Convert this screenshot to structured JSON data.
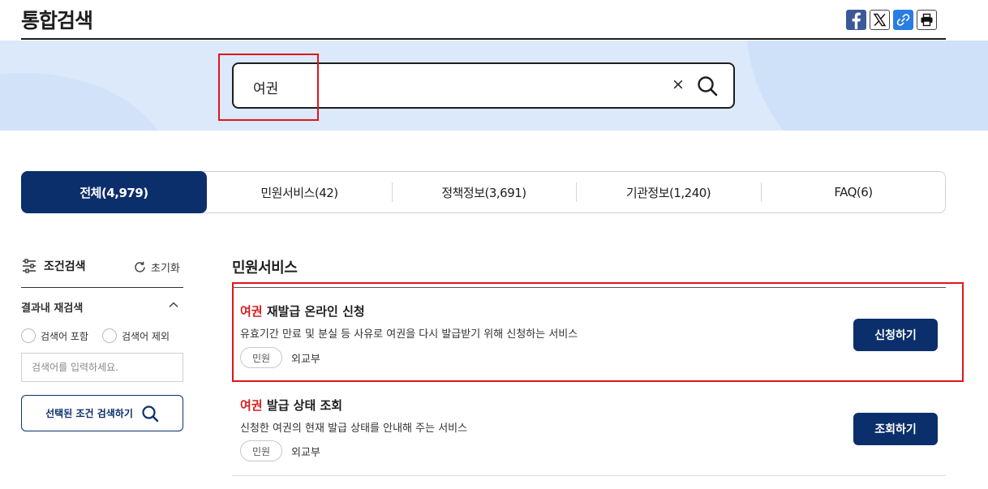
{
  "header": {
    "title": "통합검색",
    "share": [
      {
        "name": "facebook",
        "icon": "facebook-icon"
      },
      {
        "name": "x",
        "icon": "x-icon"
      },
      {
        "name": "link",
        "icon": "link-icon"
      },
      {
        "name": "print",
        "icon": "print-icon"
      }
    ]
  },
  "search": {
    "value": "여권",
    "clear_label": "×",
    "submit_icon": "search-icon"
  },
  "tabs": [
    {
      "label": "전체(4,979)",
      "active": true
    },
    {
      "label": "민원서비스(42)",
      "active": false
    },
    {
      "label": "정책정보(3,691)",
      "active": false
    },
    {
      "label": "기관정보(1,240)",
      "active": false
    },
    {
      "label": "FAQ(6)",
      "active": false
    }
  ],
  "sidebar": {
    "heading": "조건검색",
    "reset_label": "초기화",
    "refine_title": "결과내 재검색",
    "radio_include": "검색어 포함",
    "radio_exclude": "검색어 제외",
    "input_placeholder": "검색어를 입력하세요.",
    "submit_label": "선택된 조건 검색하기"
  },
  "section": {
    "title": "민원서비스",
    "results": [
      {
        "keyword": "여권",
        "title_rest": " 재발급 온라인 신청",
        "desc": "유효기간 만료 및 분실 등 사유로 여권을 다시 발급받기 위해 신청하는 서비스",
        "tag": "민원",
        "org": "외교부",
        "action": "신청하기"
      },
      {
        "keyword": "여권",
        "title_rest": " 발급 상태 조회",
        "desc": "신청한 여권의 현재 발급 상태를 안내해 주는 서비스",
        "tag": "민원",
        "org": "외교부",
        "action": "조회하기"
      }
    ]
  },
  "colors": {
    "primary": "#0b2f6b",
    "keyword": "#d81e1e",
    "highlight_box": "#e3141b",
    "hero_bg": "#dbe9fb"
  }
}
